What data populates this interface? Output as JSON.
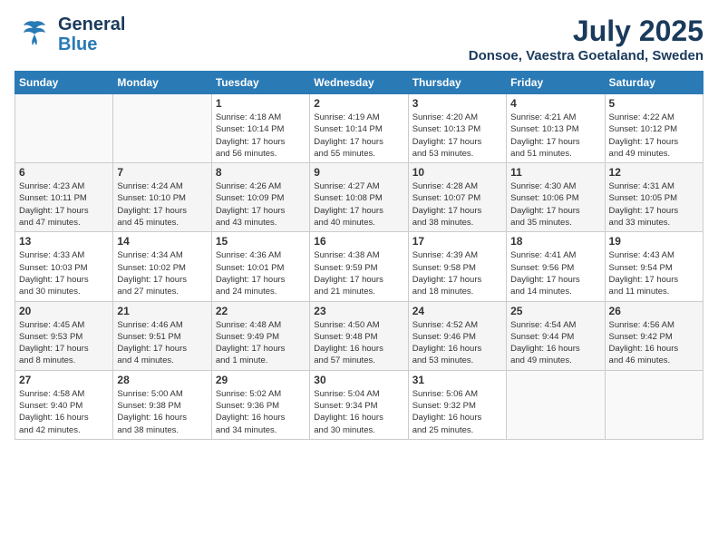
{
  "header": {
    "logo_general": "General",
    "logo_blue": "Blue",
    "month": "July 2025",
    "location": "Donsoe, Vaestra Goetaland, Sweden"
  },
  "days_of_week": [
    "Sunday",
    "Monday",
    "Tuesday",
    "Wednesday",
    "Thursday",
    "Friday",
    "Saturday"
  ],
  "weeks": [
    [
      {
        "day": "",
        "info": ""
      },
      {
        "day": "",
        "info": ""
      },
      {
        "day": "1",
        "info": "Sunrise: 4:18 AM\nSunset: 10:14 PM\nDaylight: 17 hours\nand 56 minutes."
      },
      {
        "day": "2",
        "info": "Sunrise: 4:19 AM\nSunset: 10:14 PM\nDaylight: 17 hours\nand 55 minutes."
      },
      {
        "day": "3",
        "info": "Sunrise: 4:20 AM\nSunset: 10:13 PM\nDaylight: 17 hours\nand 53 minutes."
      },
      {
        "day": "4",
        "info": "Sunrise: 4:21 AM\nSunset: 10:13 PM\nDaylight: 17 hours\nand 51 minutes."
      },
      {
        "day": "5",
        "info": "Sunrise: 4:22 AM\nSunset: 10:12 PM\nDaylight: 17 hours\nand 49 minutes."
      }
    ],
    [
      {
        "day": "6",
        "info": "Sunrise: 4:23 AM\nSunset: 10:11 PM\nDaylight: 17 hours\nand 47 minutes."
      },
      {
        "day": "7",
        "info": "Sunrise: 4:24 AM\nSunset: 10:10 PM\nDaylight: 17 hours\nand 45 minutes."
      },
      {
        "day": "8",
        "info": "Sunrise: 4:26 AM\nSunset: 10:09 PM\nDaylight: 17 hours\nand 43 minutes."
      },
      {
        "day": "9",
        "info": "Sunrise: 4:27 AM\nSunset: 10:08 PM\nDaylight: 17 hours\nand 40 minutes."
      },
      {
        "day": "10",
        "info": "Sunrise: 4:28 AM\nSunset: 10:07 PM\nDaylight: 17 hours\nand 38 minutes."
      },
      {
        "day": "11",
        "info": "Sunrise: 4:30 AM\nSunset: 10:06 PM\nDaylight: 17 hours\nand 35 minutes."
      },
      {
        "day": "12",
        "info": "Sunrise: 4:31 AM\nSunset: 10:05 PM\nDaylight: 17 hours\nand 33 minutes."
      }
    ],
    [
      {
        "day": "13",
        "info": "Sunrise: 4:33 AM\nSunset: 10:03 PM\nDaylight: 17 hours\nand 30 minutes."
      },
      {
        "day": "14",
        "info": "Sunrise: 4:34 AM\nSunset: 10:02 PM\nDaylight: 17 hours\nand 27 minutes."
      },
      {
        "day": "15",
        "info": "Sunrise: 4:36 AM\nSunset: 10:01 PM\nDaylight: 17 hours\nand 24 minutes."
      },
      {
        "day": "16",
        "info": "Sunrise: 4:38 AM\nSunset: 9:59 PM\nDaylight: 17 hours\nand 21 minutes."
      },
      {
        "day": "17",
        "info": "Sunrise: 4:39 AM\nSunset: 9:58 PM\nDaylight: 17 hours\nand 18 minutes."
      },
      {
        "day": "18",
        "info": "Sunrise: 4:41 AM\nSunset: 9:56 PM\nDaylight: 17 hours\nand 14 minutes."
      },
      {
        "day": "19",
        "info": "Sunrise: 4:43 AM\nSunset: 9:54 PM\nDaylight: 17 hours\nand 11 minutes."
      }
    ],
    [
      {
        "day": "20",
        "info": "Sunrise: 4:45 AM\nSunset: 9:53 PM\nDaylight: 17 hours\nand 8 minutes."
      },
      {
        "day": "21",
        "info": "Sunrise: 4:46 AM\nSunset: 9:51 PM\nDaylight: 17 hours\nand 4 minutes."
      },
      {
        "day": "22",
        "info": "Sunrise: 4:48 AM\nSunset: 9:49 PM\nDaylight: 17 hours\nand 1 minute."
      },
      {
        "day": "23",
        "info": "Sunrise: 4:50 AM\nSunset: 9:48 PM\nDaylight: 16 hours\nand 57 minutes."
      },
      {
        "day": "24",
        "info": "Sunrise: 4:52 AM\nSunset: 9:46 PM\nDaylight: 16 hours\nand 53 minutes."
      },
      {
        "day": "25",
        "info": "Sunrise: 4:54 AM\nSunset: 9:44 PM\nDaylight: 16 hours\nand 49 minutes."
      },
      {
        "day": "26",
        "info": "Sunrise: 4:56 AM\nSunset: 9:42 PM\nDaylight: 16 hours\nand 46 minutes."
      }
    ],
    [
      {
        "day": "27",
        "info": "Sunrise: 4:58 AM\nSunset: 9:40 PM\nDaylight: 16 hours\nand 42 minutes."
      },
      {
        "day": "28",
        "info": "Sunrise: 5:00 AM\nSunset: 9:38 PM\nDaylight: 16 hours\nand 38 minutes."
      },
      {
        "day": "29",
        "info": "Sunrise: 5:02 AM\nSunset: 9:36 PM\nDaylight: 16 hours\nand 34 minutes."
      },
      {
        "day": "30",
        "info": "Sunrise: 5:04 AM\nSunset: 9:34 PM\nDaylight: 16 hours\nand 30 minutes."
      },
      {
        "day": "31",
        "info": "Sunrise: 5:06 AM\nSunset: 9:32 PM\nDaylight: 16 hours\nand 25 minutes."
      },
      {
        "day": "",
        "info": ""
      },
      {
        "day": "",
        "info": ""
      }
    ]
  ]
}
